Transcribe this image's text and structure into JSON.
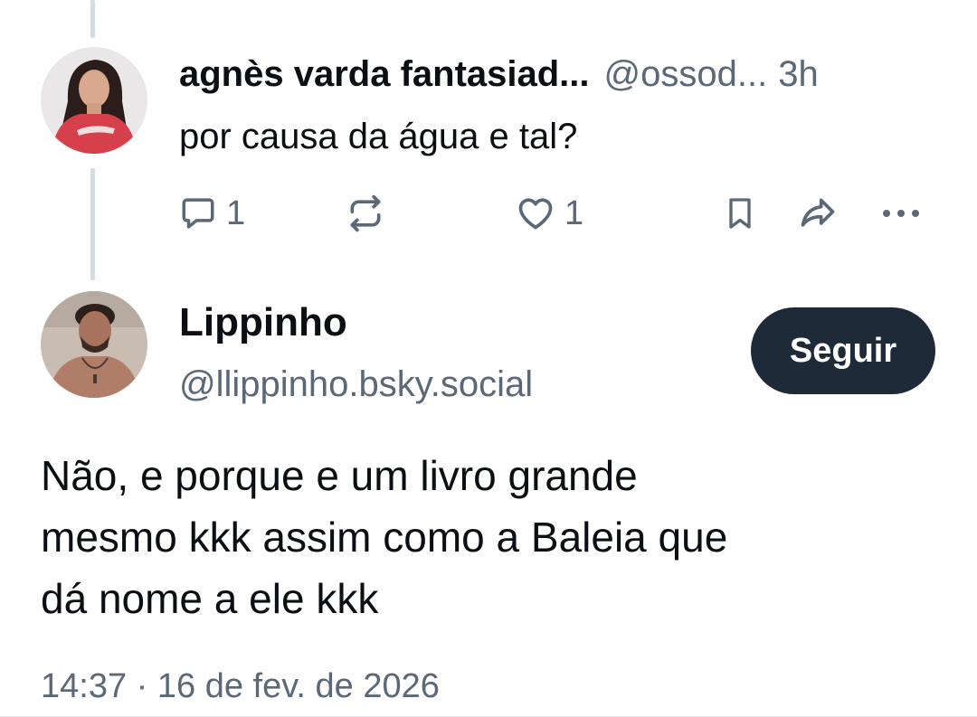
{
  "parent_post": {
    "author_name": "agnès varda fantasiad...",
    "author_handle": "@ossod...",
    "time_ago": "3h",
    "text": "por causa da água e tal?",
    "reply_count": "1",
    "like_count": "1",
    "icons": [
      "reply-icon",
      "repost-icon",
      "like-icon",
      "bookmark-icon",
      "share-icon",
      "more-icon"
    ]
  },
  "main_post": {
    "author_name": "Lippinho",
    "author_handle": "@llippinho.bsky.social",
    "follow_label": "Seguir",
    "text_lines": [
      "Não, e porque e um livro grande",
      "mesmo kkk assim como a Baleia que",
      "dá nome a ele kkk"
    ],
    "timestamp": "14:37 · 16 de fev. de 2026"
  },
  "colors": {
    "text_primary": "#0b0f14",
    "text_secondary": "#5a6877",
    "follow_button_bg": "#1e2a38",
    "thread_line": "#d4dbe2"
  }
}
